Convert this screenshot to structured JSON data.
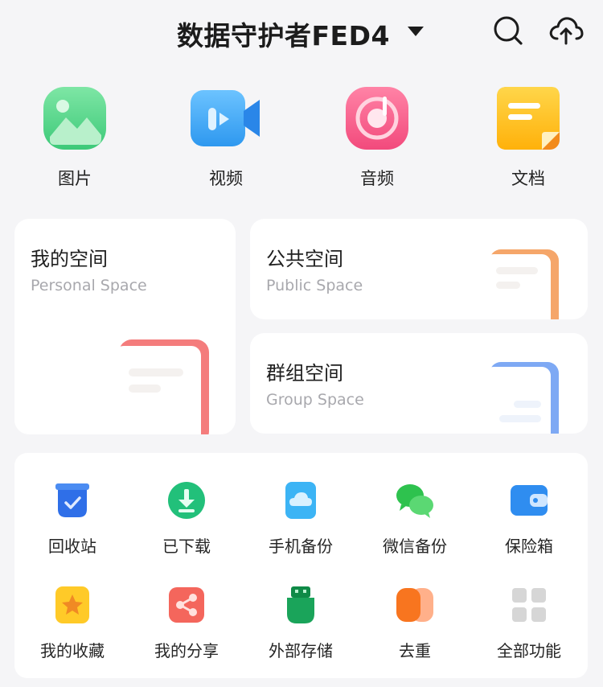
{
  "header": {
    "title": "数据守护者FED4",
    "icons": [
      "chevron-down-icon",
      "search-icon",
      "cloud-upload-icon"
    ]
  },
  "categories": [
    {
      "label": "图片",
      "icon": "image-icon",
      "color": "#4cd28a"
    },
    {
      "label": "视频",
      "icon": "video-icon",
      "color": "#3aa2f3"
    },
    {
      "label": "音频",
      "icon": "music-icon",
      "color": "#f55a8a"
    },
    {
      "label": "文档",
      "icon": "document-icon",
      "color": "#ffc21a"
    }
  ],
  "spaces": {
    "personal": {
      "title": "我的空间",
      "subtitle": "Personal Space",
      "accent": "#f47c7c"
    },
    "public": {
      "title": "公共空间",
      "subtitle": "Public Space",
      "accent": "#f5a66a"
    },
    "group": {
      "title": "群组空间",
      "subtitle": "Group Space",
      "accent": "#7ea9f4"
    }
  },
  "tools": [
    {
      "label": "回收站",
      "icon": "recycle-bin-icon",
      "color": "#2f6fe8"
    },
    {
      "label": "已下载",
      "icon": "download-icon",
      "color": "#22c07a"
    },
    {
      "label": "手机备份",
      "icon": "phone-backup-icon",
      "color": "#3cb4f5"
    },
    {
      "label": "微信备份",
      "icon": "wechat-icon",
      "color": "#2ec24e"
    },
    {
      "label": "保险箱",
      "icon": "wallet-icon",
      "color": "#2f8df0"
    },
    {
      "label": "我的收藏",
      "icon": "star-icon",
      "color": "#ffca28"
    },
    {
      "label": "我的分享",
      "icon": "share-icon",
      "color": "#f4665c"
    },
    {
      "label": "外部存储",
      "icon": "usb-icon",
      "color": "#1aa45a"
    },
    {
      "label": "去重",
      "icon": "dedupe-icon",
      "color": "#f8751f"
    },
    {
      "label": "全部功能",
      "icon": "grid-icon",
      "color": "#d6d6d6"
    }
  ]
}
